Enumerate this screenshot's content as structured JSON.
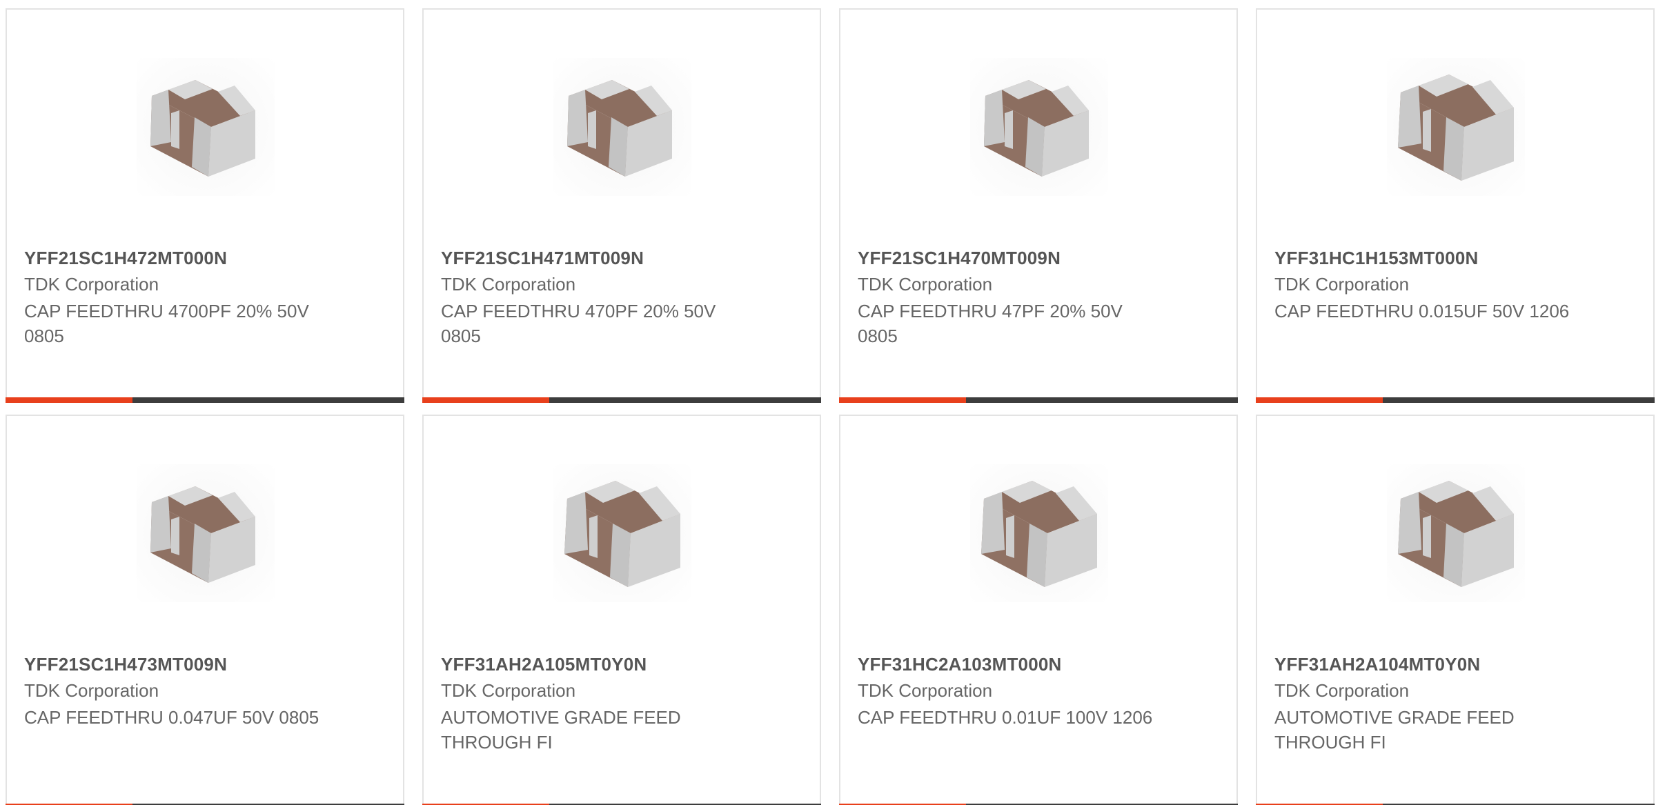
{
  "products": [
    {
      "part_number": "YFF21SC1H472MT000N",
      "manufacturer": "TDK Corporation",
      "description": "CAP FEEDTHRU 4700PF 20% 50V 0805",
      "image_icon": "capacitor-chip-icon"
    },
    {
      "part_number": "YFF21SC1H471MT009N",
      "manufacturer": "TDK Corporation",
      "description": "CAP FEEDTHRU 470PF 20% 50V 0805",
      "image_icon": "capacitor-chip-icon"
    },
    {
      "part_number": "YFF21SC1H470MT009N",
      "manufacturer": "TDK Corporation",
      "description": "CAP FEEDTHRU 47PF 20% 50V 0805",
      "image_icon": "capacitor-chip-icon"
    },
    {
      "part_number": "YFF31HC1H153MT000N",
      "manufacturer": "TDK Corporation",
      "description": "CAP FEEDTHRU 0.015UF 50V 1206",
      "image_icon": "capacitor-chip-icon"
    },
    {
      "part_number": "YFF21SC1H473MT009N",
      "manufacturer": "TDK Corporation",
      "description": "CAP FEEDTHRU 0.047UF 50V 0805",
      "image_icon": "capacitor-chip-icon"
    },
    {
      "part_number": "YFF31AH2A105MT0Y0N",
      "manufacturer": "TDK Corporation",
      "description": "AUTOMOTIVE GRADE FEED THROUGH FI",
      "image_icon": "capacitor-chip-icon"
    },
    {
      "part_number": "YFF31HC2A103MT000N",
      "manufacturer": "TDK Corporation",
      "description": "CAP FEEDTHRU 0.01UF 100V 1206",
      "image_icon": "capacitor-chip-icon"
    },
    {
      "part_number": "YFF31AH2A104MT0Y0N",
      "manufacturer": "TDK Corporation",
      "description": "AUTOMOTIVE GRADE FEED THROUGH FI",
      "image_icon": "capacitor-chip-icon"
    }
  ],
  "colors": {
    "accent": "#e8401c",
    "bar": "#3d3d3d",
    "chip_body": "#8c6e60",
    "chip_terminal": "#c9c9c9"
  }
}
